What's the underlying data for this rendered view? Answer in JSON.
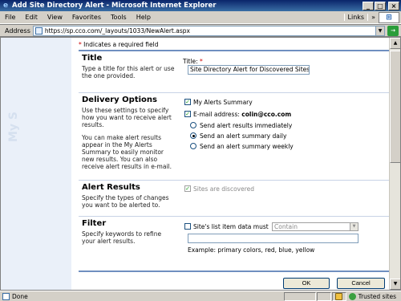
{
  "window": {
    "title": "Add Site Directory Alert - Microsoft Internet Explorer",
    "minimize": "_",
    "maximize": "□",
    "close": "×"
  },
  "menu": [
    {
      "label": "File"
    },
    {
      "label": "Edit"
    },
    {
      "label": "View"
    },
    {
      "label": "Favorites"
    },
    {
      "label": "Tools"
    },
    {
      "label": "Help"
    }
  ],
  "toolbar": {
    "links_label": "Links",
    "links_chevron": "»"
  },
  "address": {
    "label": "Address",
    "url": "https://sp.cco.com/_layouts/1033/NewAlert.aspx"
  },
  "sidebar": {
    "watermark": "My S"
  },
  "form": {
    "required_note": "Indicates a required field",
    "required_star": "*",
    "title_section": {
      "heading": "Title",
      "description": "Type a title for this alert or use the one provided.",
      "field_label": "Title:",
      "field_value": "Site Directory Alert for Discovered Sites"
    },
    "delivery_section": {
      "heading": "Delivery Options",
      "description": "Use these settings to specify how you want to receive alert results.",
      "description2": "You can make alert results appear in the My Alerts Summary to easily monitor new results. You can also receive alert results in e-mail.",
      "my_alerts_label": "My Alerts Summary",
      "email_label": "E-mail address:",
      "email_value": "colin@cco.com",
      "options": [
        {
          "label": "Send alert results immediately",
          "checked": false
        },
        {
          "label": "Send an alert summary daily",
          "checked": true
        },
        {
          "label": "Send an alert summary weekly",
          "checked": false
        }
      ]
    },
    "results_section": {
      "heading": "Alert Results",
      "description": "Specify the types of changes you want to be alerted to.",
      "sites_label": "Sites are discovered"
    },
    "filter_section": {
      "heading": "Filter",
      "description": "Specify keywords to refine your alert results.",
      "data_must_label": "Site's list item data must",
      "operator_value": "Contain",
      "keywords_value": "",
      "example": "Example: primary colors, red, blue, yellow"
    },
    "ok_label": "OK",
    "cancel_label": "Cancel"
  },
  "status": {
    "text": "Done",
    "zone": "Trusted sites"
  },
  "colors": {
    "accent_line": "#6f8fc0",
    "title_bar": "#0a246a",
    "check_green": "#21a121"
  }
}
